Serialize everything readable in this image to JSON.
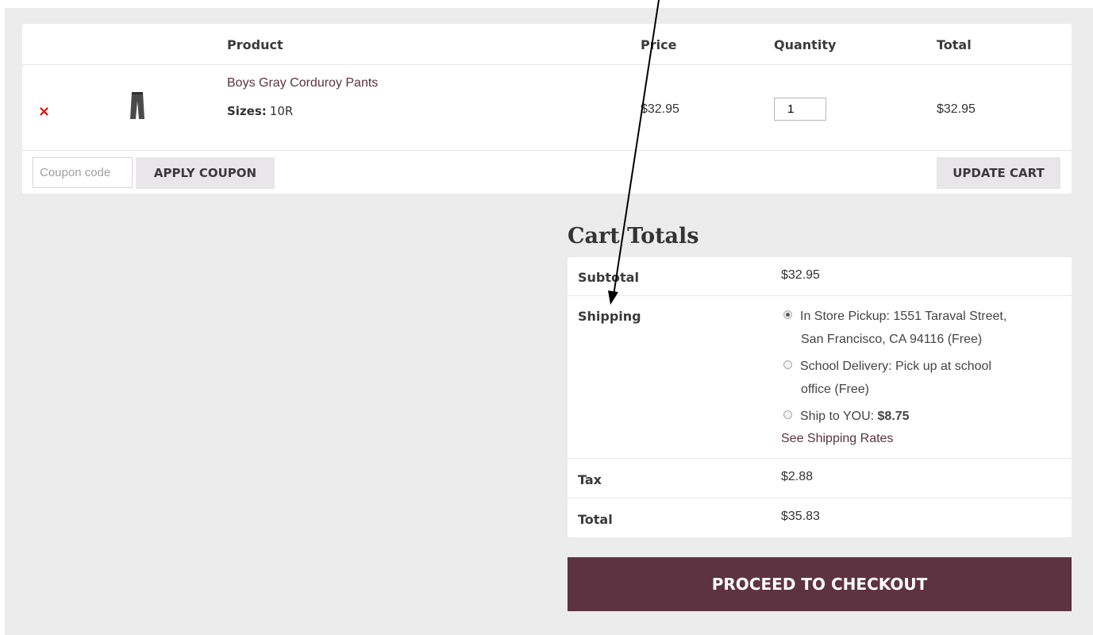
{
  "cart": {
    "headers": {
      "product": "Product",
      "price": "Price",
      "quantity": "Quantity",
      "total": "Total"
    },
    "remove_symbol": "×",
    "item": {
      "name": "Boys Gray Corduroy Pants",
      "size_label": "Sizes:",
      "size_value": "10R",
      "price": "$32.95",
      "quantity": "1",
      "total": "$32.95"
    },
    "coupon_placeholder": "Coupon code",
    "apply_coupon_label": "APPLY COUPON",
    "update_cart_label": "UPDATE CART"
  },
  "cart_totals": {
    "title": "Cart Totals",
    "subtotal_label": "Subtotal",
    "subtotal_value": "$32.95",
    "shipping_label": "Shipping",
    "shipping_options": [
      {
        "line1": "In Store Pickup: 1551 Taraval Street,",
        "line2": "San Francisco, CA 94116 (Free)",
        "selected": true
      },
      {
        "line1": "School Delivery: Pick up at school",
        "line2": "office (Free)",
        "selected": false
      },
      {
        "line1": "Ship to YOU: ",
        "amount": "$8.75",
        "selected": false
      }
    ],
    "see_rates_label": "See Shipping Rates",
    "tax_label": "Tax",
    "tax_value": "$2.88",
    "total_label": "Total",
    "total_value": "$35.83"
  },
  "checkout_label": "PROCEED TO CHECKOUT",
  "colors": {
    "brand": "#5e3341",
    "remove": "#e00000",
    "background": "#ececec"
  }
}
